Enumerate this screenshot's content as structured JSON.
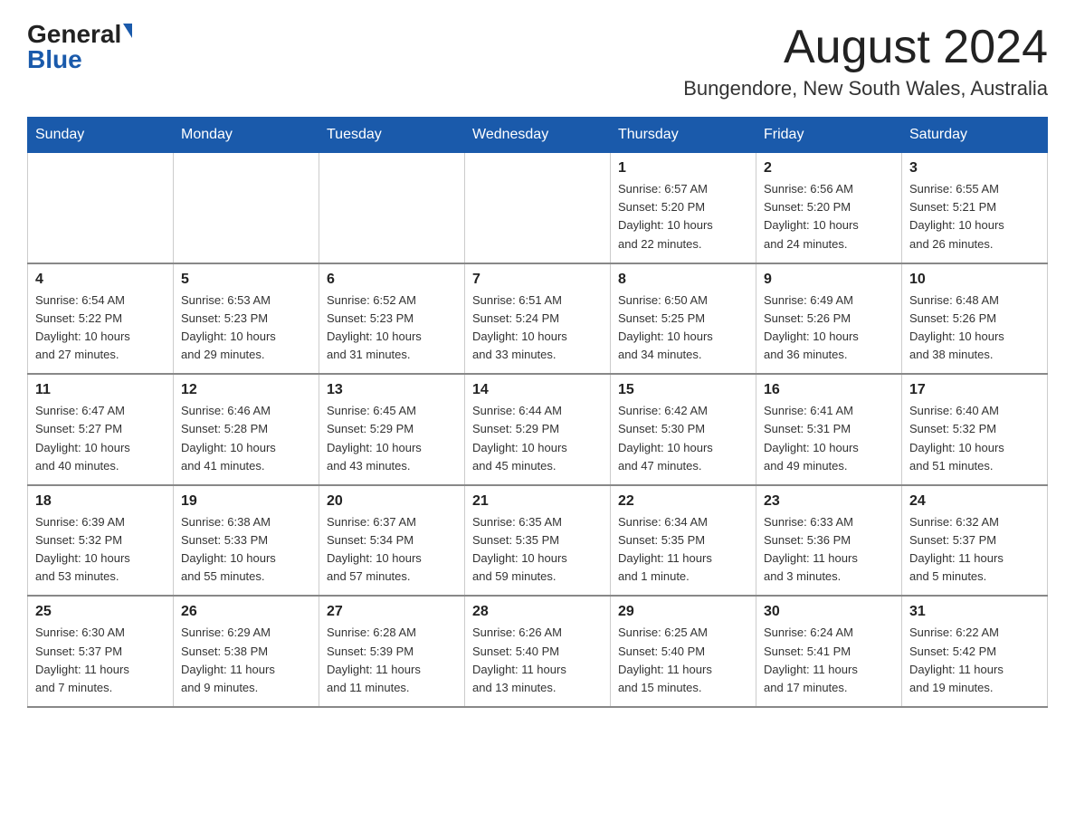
{
  "logo": {
    "general": "General",
    "blue": "Blue"
  },
  "title": "August 2024",
  "subtitle": "Bungendore, New South Wales, Australia",
  "days_of_week": [
    "Sunday",
    "Monday",
    "Tuesday",
    "Wednesday",
    "Thursday",
    "Friday",
    "Saturday"
  ],
  "weeks": [
    [
      {
        "day": "",
        "info": ""
      },
      {
        "day": "",
        "info": ""
      },
      {
        "day": "",
        "info": ""
      },
      {
        "day": "",
        "info": ""
      },
      {
        "day": "1",
        "info": "Sunrise: 6:57 AM\nSunset: 5:20 PM\nDaylight: 10 hours\nand 22 minutes."
      },
      {
        "day": "2",
        "info": "Sunrise: 6:56 AM\nSunset: 5:20 PM\nDaylight: 10 hours\nand 24 minutes."
      },
      {
        "day": "3",
        "info": "Sunrise: 6:55 AM\nSunset: 5:21 PM\nDaylight: 10 hours\nand 26 minutes."
      }
    ],
    [
      {
        "day": "4",
        "info": "Sunrise: 6:54 AM\nSunset: 5:22 PM\nDaylight: 10 hours\nand 27 minutes."
      },
      {
        "day": "5",
        "info": "Sunrise: 6:53 AM\nSunset: 5:23 PM\nDaylight: 10 hours\nand 29 minutes."
      },
      {
        "day": "6",
        "info": "Sunrise: 6:52 AM\nSunset: 5:23 PM\nDaylight: 10 hours\nand 31 minutes."
      },
      {
        "day": "7",
        "info": "Sunrise: 6:51 AM\nSunset: 5:24 PM\nDaylight: 10 hours\nand 33 minutes."
      },
      {
        "day": "8",
        "info": "Sunrise: 6:50 AM\nSunset: 5:25 PM\nDaylight: 10 hours\nand 34 minutes."
      },
      {
        "day": "9",
        "info": "Sunrise: 6:49 AM\nSunset: 5:26 PM\nDaylight: 10 hours\nand 36 minutes."
      },
      {
        "day": "10",
        "info": "Sunrise: 6:48 AM\nSunset: 5:26 PM\nDaylight: 10 hours\nand 38 minutes."
      }
    ],
    [
      {
        "day": "11",
        "info": "Sunrise: 6:47 AM\nSunset: 5:27 PM\nDaylight: 10 hours\nand 40 minutes."
      },
      {
        "day": "12",
        "info": "Sunrise: 6:46 AM\nSunset: 5:28 PM\nDaylight: 10 hours\nand 41 minutes."
      },
      {
        "day": "13",
        "info": "Sunrise: 6:45 AM\nSunset: 5:29 PM\nDaylight: 10 hours\nand 43 minutes."
      },
      {
        "day": "14",
        "info": "Sunrise: 6:44 AM\nSunset: 5:29 PM\nDaylight: 10 hours\nand 45 minutes."
      },
      {
        "day": "15",
        "info": "Sunrise: 6:42 AM\nSunset: 5:30 PM\nDaylight: 10 hours\nand 47 minutes."
      },
      {
        "day": "16",
        "info": "Sunrise: 6:41 AM\nSunset: 5:31 PM\nDaylight: 10 hours\nand 49 minutes."
      },
      {
        "day": "17",
        "info": "Sunrise: 6:40 AM\nSunset: 5:32 PM\nDaylight: 10 hours\nand 51 minutes."
      }
    ],
    [
      {
        "day": "18",
        "info": "Sunrise: 6:39 AM\nSunset: 5:32 PM\nDaylight: 10 hours\nand 53 minutes."
      },
      {
        "day": "19",
        "info": "Sunrise: 6:38 AM\nSunset: 5:33 PM\nDaylight: 10 hours\nand 55 minutes."
      },
      {
        "day": "20",
        "info": "Sunrise: 6:37 AM\nSunset: 5:34 PM\nDaylight: 10 hours\nand 57 minutes."
      },
      {
        "day": "21",
        "info": "Sunrise: 6:35 AM\nSunset: 5:35 PM\nDaylight: 10 hours\nand 59 minutes."
      },
      {
        "day": "22",
        "info": "Sunrise: 6:34 AM\nSunset: 5:35 PM\nDaylight: 11 hours\nand 1 minute."
      },
      {
        "day": "23",
        "info": "Sunrise: 6:33 AM\nSunset: 5:36 PM\nDaylight: 11 hours\nand 3 minutes."
      },
      {
        "day": "24",
        "info": "Sunrise: 6:32 AM\nSunset: 5:37 PM\nDaylight: 11 hours\nand 5 minutes."
      }
    ],
    [
      {
        "day": "25",
        "info": "Sunrise: 6:30 AM\nSunset: 5:37 PM\nDaylight: 11 hours\nand 7 minutes."
      },
      {
        "day": "26",
        "info": "Sunrise: 6:29 AM\nSunset: 5:38 PM\nDaylight: 11 hours\nand 9 minutes."
      },
      {
        "day": "27",
        "info": "Sunrise: 6:28 AM\nSunset: 5:39 PM\nDaylight: 11 hours\nand 11 minutes."
      },
      {
        "day": "28",
        "info": "Sunrise: 6:26 AM\nSunset: 5:40 PM\nDaylight: 11 hours\nand 13 minutes."
      },
      {
        "day": "29",
        "info": "Sunrise: 6:25 AM\nSunset: 5:40 PM\nDaylight: 11 hours\nand 15 minutes."
      },
      {
        "day": "30",
        "info": "Sunrise: 6:24 AM\nSunset: 5:41 PM\nDaylight: 11 hours\nand 17 minutes."
      },
      {
        "day": "31",
        "info": "Sunrise: 6:22 AM\nSunset: 5:42 PM\nDaylight: 11 hours\nand 19 minutes."
      }
    ]
  ]
}
